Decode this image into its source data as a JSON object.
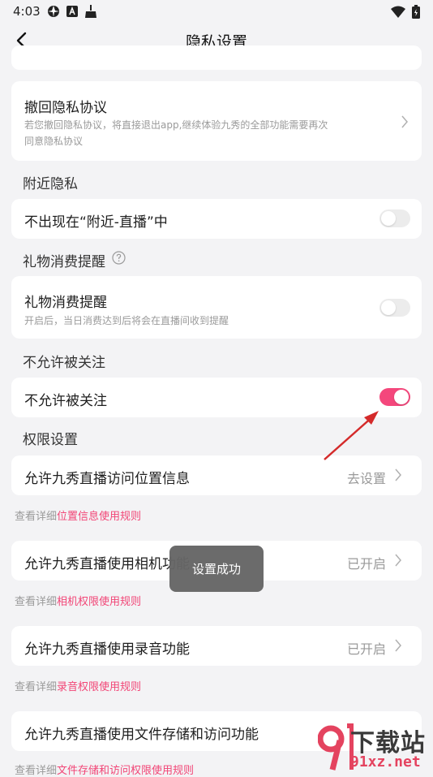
{
  "status_bar": {
    "time": "4:03"
  },
  "header": {
    "title": "隐私设置"
  },
  "revoke": {
    "title": "撤回隐私协议",
    "desc_line1": "若您撤回隐私协议，将直接退出app,继续体验九秀的全部功能需要再次",
    "desc_line2": "同意隐私协议"
  },
  "nearby": {
    "section_label": "附近隐私",
    "item_label": "不出现在“附近-直播”中",
    "enabled": false
  },
  "gift": {
    "section_label": "礼物消费提醒",
    "item_label": "礼物消费提醒",
    "desc": "开启后，当日消费达到后将会在直播间收到提醒",
    "enabled": false
  },
  "follow": {
    "section_label": "不允许被关注",
    "item_label": "不允许被关注",
    "enabled": true
  },
  "permissions": {
    "section_label": "权限设置",
    "location": {
      "label": "允许九秀直播访问位置信息",
      "value": "去设置",
      "note_prefix": "查看详细",
      "note_link": "位置信息使用规则"
    },
    "camera": {
      "label": "允许九秀直播使用相机功能",
      "value": "已开启",
      "note_prefix": "查看详细",
      "note_link": "相机权限使用规则"
    },
    "microphone": {
      "label": "允许九秀直播使用录音功能",
      "value": "已开启",
      "note_prefix": "查看详细",
      "note_link": "录音权限使用规则"
    },
    "storage": {
      "label": "允许九秀直播使用文件存储和访问功能",
      "note_prefix": "查看详细",
      "note_link": "文件存储和访问权限使用规则"
    }
  },
  "toast": {
    "text": "设置成功"
  },
  "watermark": {
    "text_top": "下载站",
    "text_bottom": "91xz.net"
  },
  "colors": {
    "accent": "#f4477c",
    "background": "#f3f3f5",
    "card": "#ffffff",
    "annotation_arrow": "#d42a2a"
  }
}
